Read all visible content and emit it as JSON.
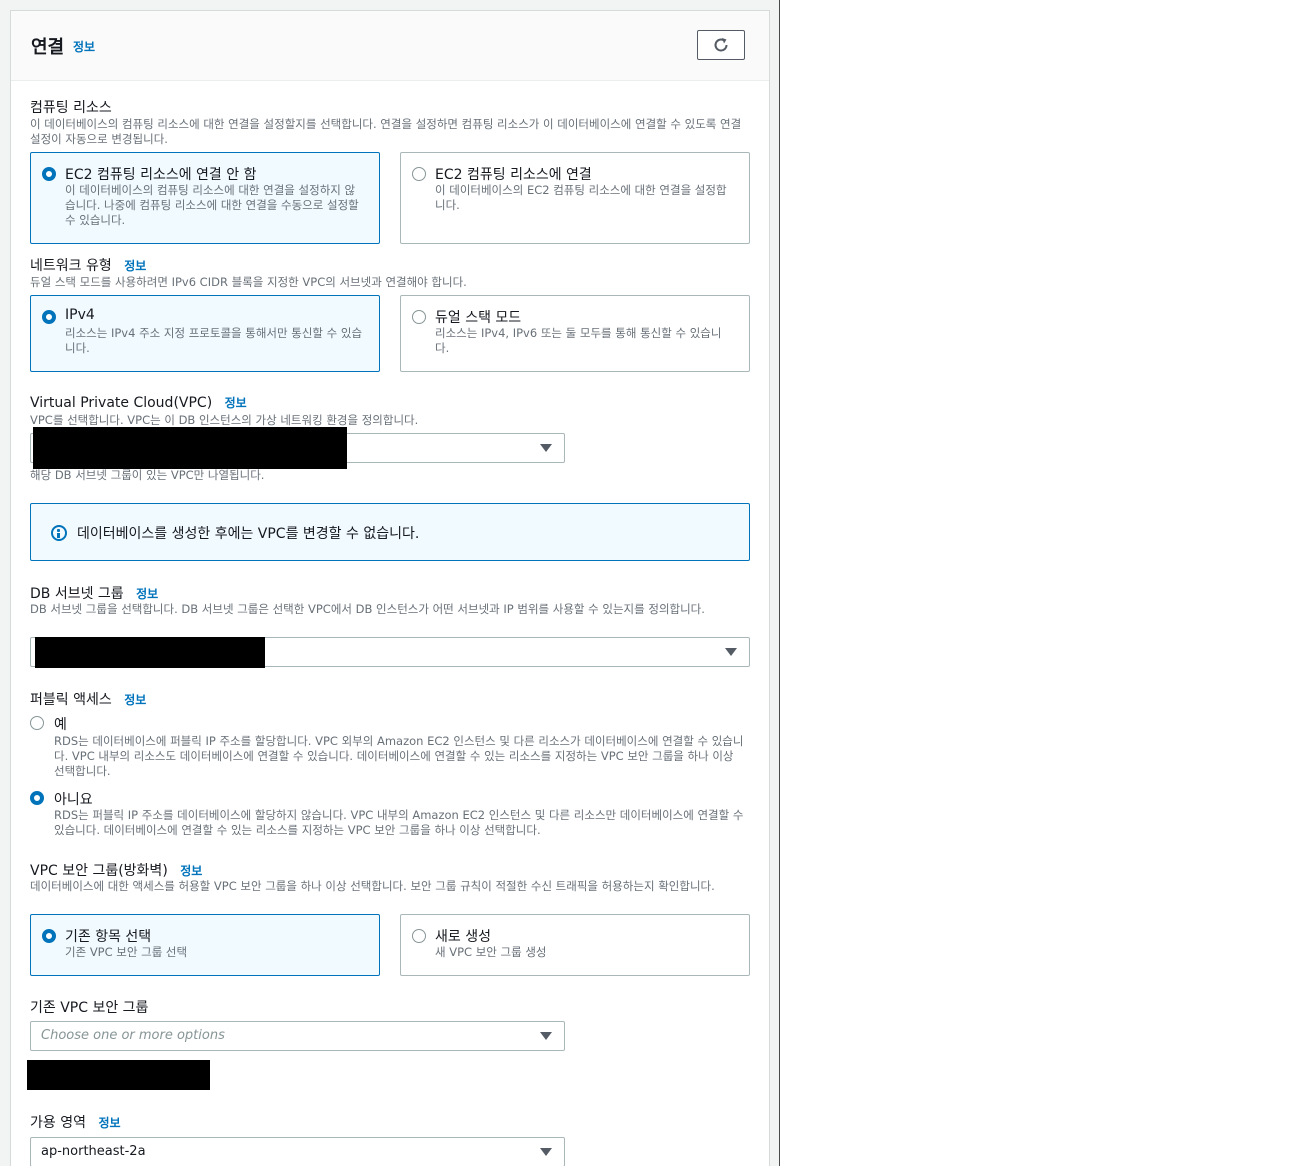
{
  "header": {
    "title": "연결",
    "info": "정보"
  },
  "compute": {
    "label": "컴퓨팅 리소스",
    "description": "이 데이터베이스의 컴퓨팅 리소스에 대한 연결을 설정할지를 선택합니다. 연결을 설정하면 컴퓨팅 리소스가 이 데이터베이스에 연결할 수 있도록 연결 설정이 자동으로 변경됩니다.",
    "options": [
      {
        "label": "EC2 컴퓨팅 리소스에 연결 안 함",
        "description": "이 데이터베이스의 컴퓨팅 리소스에 대한 연결을 설정하지 않습니다. 나중에 컴퓨팅 리소스에 대한 연결을 수동으로 설정할 수 있습니다.",
        "selected": true
      },
      {
        "label": "EC2 컴퓨팅 리소스에 연결",
        "description": "이 데이터베이스의 EC2 컴퓨팅 리소스에 대한 연결을 설정합니다.",
        "selected": false
      }
    ]
  },
  "network": {
    "label": "네트워크 유형",
    "info": "정보",
    "description": "듀얼 스택 모드를 사용하려면 IPv6 CIDR 블록을 지정한 VPC의 서브넷과 연결해야 합니다.",
    "options": [
      {
        "label": "IPv4",
        "description": "리소스는 IPv4 주소 지정 프로토콜을 통해서만 통신할 수 있습니다.",
        "selected": true
      },
      {
        "label": "듀얼 스택 모드",
        "description": "리소스는 IPv4, IPv6 또는 둘 모두를 통해 통신할 수 있습니다.",
        "selected": false
      }
    ]
  },
  "vpc": {
    "label": "Virtual Private Cloud(VPC)",
    "info": "정보",
    "description": "VPC를 선택합니다. VPC는 이 DB 인스턴스의 가상 네트워킹 환경을 정의합니다.",
    "hint": "해당 DB 서브넷 그룹이 있는 VPC만 나열됩니다.",
    "alert": "데이터베이스를 생성한 후에는 VPC를 변경할 수 없습니다."
  },
  "subnet": {
    "label": "DB 서브넷 그룹",
    "info": "정보",
    "description": "DB 서브넷 그룹을 선택합니다. DB 서브넷 그룹은 선택한 VPC에서 DB 인스턴스가 어떤 서브넷과 IP 범위를 사용할 수 있는지를 정의합니다."
  },
  "public": {
    "label": "퍼블릭 액세스",
    "info": "정보",
    "options": [
      {
        "label": "예",
        "description": "RDS는 데이터베이스에 퍼블릭 IP 주소를 할당합니다. VPC 외부의 Amazon EC2 인스턴스 및 다른 리소스가 데이터베이스에 연결할 수 있습니다. VPC 내부의 리소스도 데이터베이스에 연결할 수 있습니다. 데이터베이스에 연결할 수 있는 리소스를 지정하는 VPC 보안 그룹을 하나 이상 선택합니다.",
        "selected": false
      },
      {
        "label": "아니요",
        "description": "RDS는 퍼블릭 IP 주소를 데이터베이스에 할당하지 않습니다. VPC 내부의 Amazon EC2 인스턴스 및 다른 리소스만 데이터베이스에 연결할 수 있습니다. 데이터베이스에 연결할 수 있는 리소스를 지정하는 VPC 보안 그룹을 하나 이상 선택합니다.",
        "selected": true
      }
    ]
  },
  "security": {
    "label": "VPC 보안 그룹(방화벽)",
    "info": "정보",
    "description": "데이터베이스에 대한 액세스를 허용할 VPC 보안 그룹을 하나 이상 선택합니다. 보안 그룹 규칙이 적절한 수신 트래픽을 허용하는지 확인합니다.",
    "options": [
      {
        "label": "기존 항목 선택",
        "description": "기존 VPC 보안 그룹 선택",
        "selected": true
      },
      {
        "label": "새로 생성",
        "description": "새 VPC 보안 그룹 생성",
        "selected": false
      }
    ]
  },
  "existing_sg": {
    "label": "기존 VPC 보안 그룹",
    "placeholder": "Choose one or more options"
  },
  "az": {
    "label": "가용 영역",
    "info": "정보",
    "value": "ap-northeast-2a"
  },
  "colors": {
    "accent": "#0073bb",
    "selected_bg": "#f1faff",
    "border": "#aab7b8"
  }
}
